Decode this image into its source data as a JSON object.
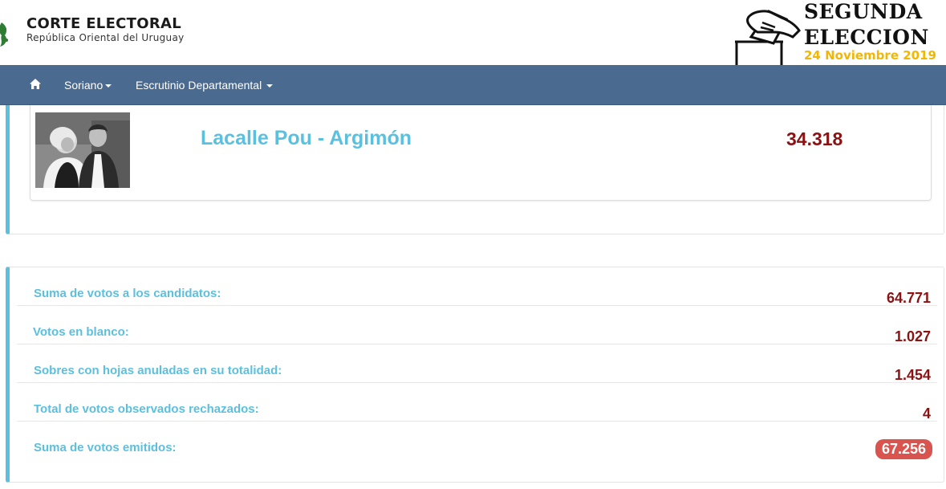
{
  "header": {
    "org_title": "CORTE ELECTORAL",
    "org_subtitle": "República Oriental del Uruguay",
    "election_line1": "SEGUNDA",
    "election_line2": "ELECCION",
    "election_date": "24 Noviembre 2019"
  },
  "navbar": {
    "home_icon": "home-icon",
    "items": [
      {
        "label": "Soriano"
      },
      {
        "label": "Escrutinio Departamental"
      }
    ]
  },
  "candidate": {
    "name": "Lacalle Pou - Argimón",
    "votes": "34.318"
  },
  "totals": [
    {
      "label": "Suma de votos a los candidatos:",
      "value": "64.771"
    },
    {
      "label": "Votos en blanco:",
      "value": "1.027"
    },
    {
      "label": "Sobres con hojas anuladas en su totalidad:",
      "value": "1.454"
    },
    {
      "label": "Total de votos observados rechazados:",
      "value": "4"
    },
    {
      "label": "Suma de votos emitidos:",
      "value": "67.256"
    }
  ],
  "colors": {
    "navbar": "#4a6b8f",
    "accent": "#5bc0de",
    "value": "#8b1212",
    "badge": "#d9534f",
    "date": "#f2b705"
  }
}
